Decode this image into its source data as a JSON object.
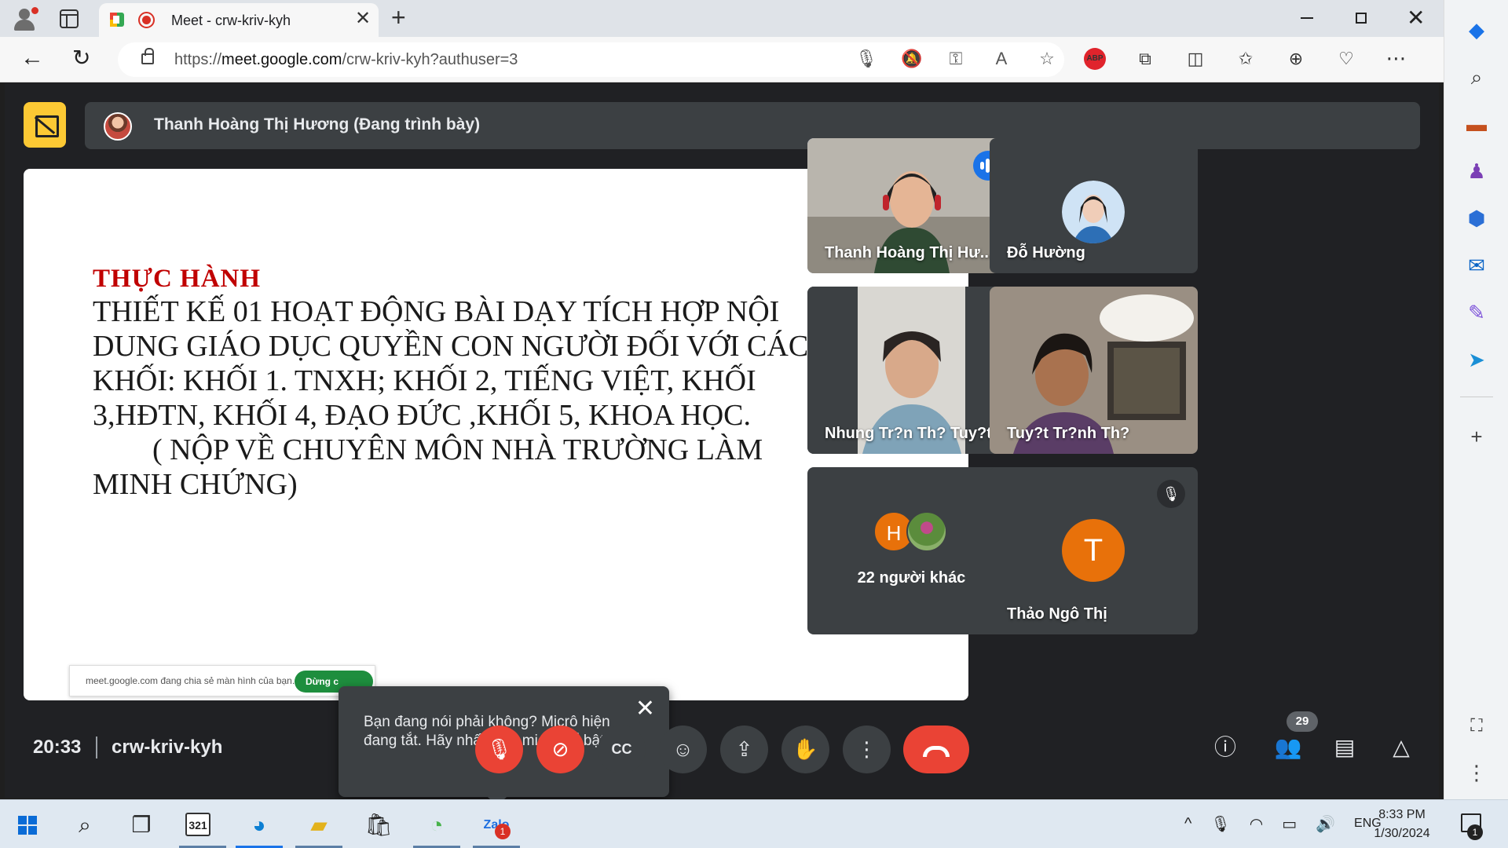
{
  "browser": {
    "tab_title": "Meet - crw-kriv-kyh",
    "url_prefix": "https://",
    "url_host": "meet.google.com",
    "url_path": "/crw-kriv-kyh?authuser=3",
    "abp_label": "ABP"
  },
  "meet": {
    "presenter_banner": "Thanh Hoàng Thị Hương (Đang trình bày)",
    "slide": {
      "heading": "THỰC   HÀNH",
      "lines": [
        "THIẾT KẾ 01 HOẠT ĐỘNG BÀI DẠY TÍCH HỢP NỘI",
        "DUNG GIÁO DỤC QUYỀN CON NGƯỜI ĐỐI VỚI CÁC",
        "KHỐI: KHỐI 1. TNXH; KHỐI 2, TIẾNG VIỆT, KHỐI",
        "3,HĐTN, KHỐI 4, ĐẠO ĐỨC ,KHỐI 5, KHOA HỌC.",
        "        ( NỘP VỀ CHUYÊN MÔN NHÀ TRƯỜNG LÀM",
        "MINH CHỨNG)"
      ]
    },
    "share_bar": {
      "message": "meet.google.com đang chia sẻ màn hình của bạn.",
      "stop_label": "Dừng c"
    },
    "participants": [
      {
        "name": "Thanh Hoàng Thị Hư..."
      },
      {
        "name": "Đỗ Hường"
      },
      {
        "name": "Nhung Tr?n Th? Tuy?t"
      },
      {
        "name": "Tuy?t Tr?nh Th?"
      },
      {
        "name": "Thảo Ngô Thị",
        "letter": "T"
      }
    ],
    "others": {
      "letter": "H",
      "text": "22 người khác"
    },
    "tooltip": "Bạn đang nói phải không? Micrô hiện đang tắt. Hãy nhấp vào micrô để bật.",
    "time": "20:33",
    "meeting_code": "crw-kriv-kyh",
    "people_count": "29"
  },
  "taskbar": {
    "calendar_label": "321",
    "zalo_badge": "1",
    "language": "ENG",
    "time": "8:33 PM",
    "date": "1/30/2024",
    "notification_count": "1"
  },
  "colors": {
    "meet_bg": "#202124",
    "tile_bg": "#3c4043",
    "danger": "#ea4335",
    "active_outline": "#8ab4f8",
    "presenting_yellow": "#fcc934",
    "avatar_orange": "#e8710a"
  }
}
